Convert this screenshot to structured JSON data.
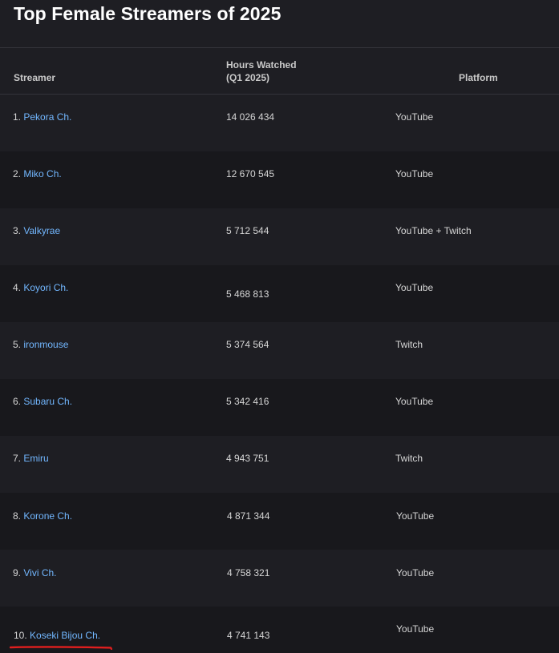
{
  "title": "Top Female Streamers of 2025",
  "table": {
    "headers": {
      "streamer": "Streamer",
      "hours_line1": "Hours Watched",
      "hours_line2": "(Q1 2025)",
      "platform": "Platform"
    },
    "rows": [
      {
        "rank": "1.",
        "name": "Pekora Ch.",
        "hours": "14 026 434",
        "platform": "YouTube"
      },
      {
        "rank": "2.",
        "name": "Miko Ch.",
        "hours": "12 670 545",
        "platform": "YouTube"
      },
      {
        "rank": "3.",
        "name": "Valkyrae",
        "hours": "5 712 544",
        "platform": "YouTube + Twitch"
      },
      {
        "rank": "4.",
        "name": "Koyori Ch.",
        "hours": "5 468 813",
        "platform": "YouTube"
      },
      {
        "rank": "5.",
        "name": "ironmouse",
        "hours": "5 374 564",
        "platform": "Twitch"
      },
      {
        "rank": "6.",
        "name": "Subaru Ch.",
        "hours": "5 342 416",
        "platform": "YouTube"
      },
      {
        "rank": "7.",
        "name": "Emiru",
        "hours": "4 943 751",
        "platform": "Twitch"
      },
      {
        "rank": "8.",
        "name": "Korone Ch.",
        "hours": "4 871 344",
        "platform": "YouTube"
      },
      {
        "rank": "9.",
        "name": "Vivi Ch.",
        "hours": "4 758 321",
        "platform": "YouTube"
      },
      {
        "rank": "10.",
        "name": "Koseki Bijou Ch.",
        "hours": "4 741 143",
        "platform": "YouTube"
      }
    ]
  },
  "colors": {
    "background": "#1e1e23",
    "row_alt": "#18181c",
    "link": "#72b7ff",
    "annotation": "#e01e1e"
  }
}
